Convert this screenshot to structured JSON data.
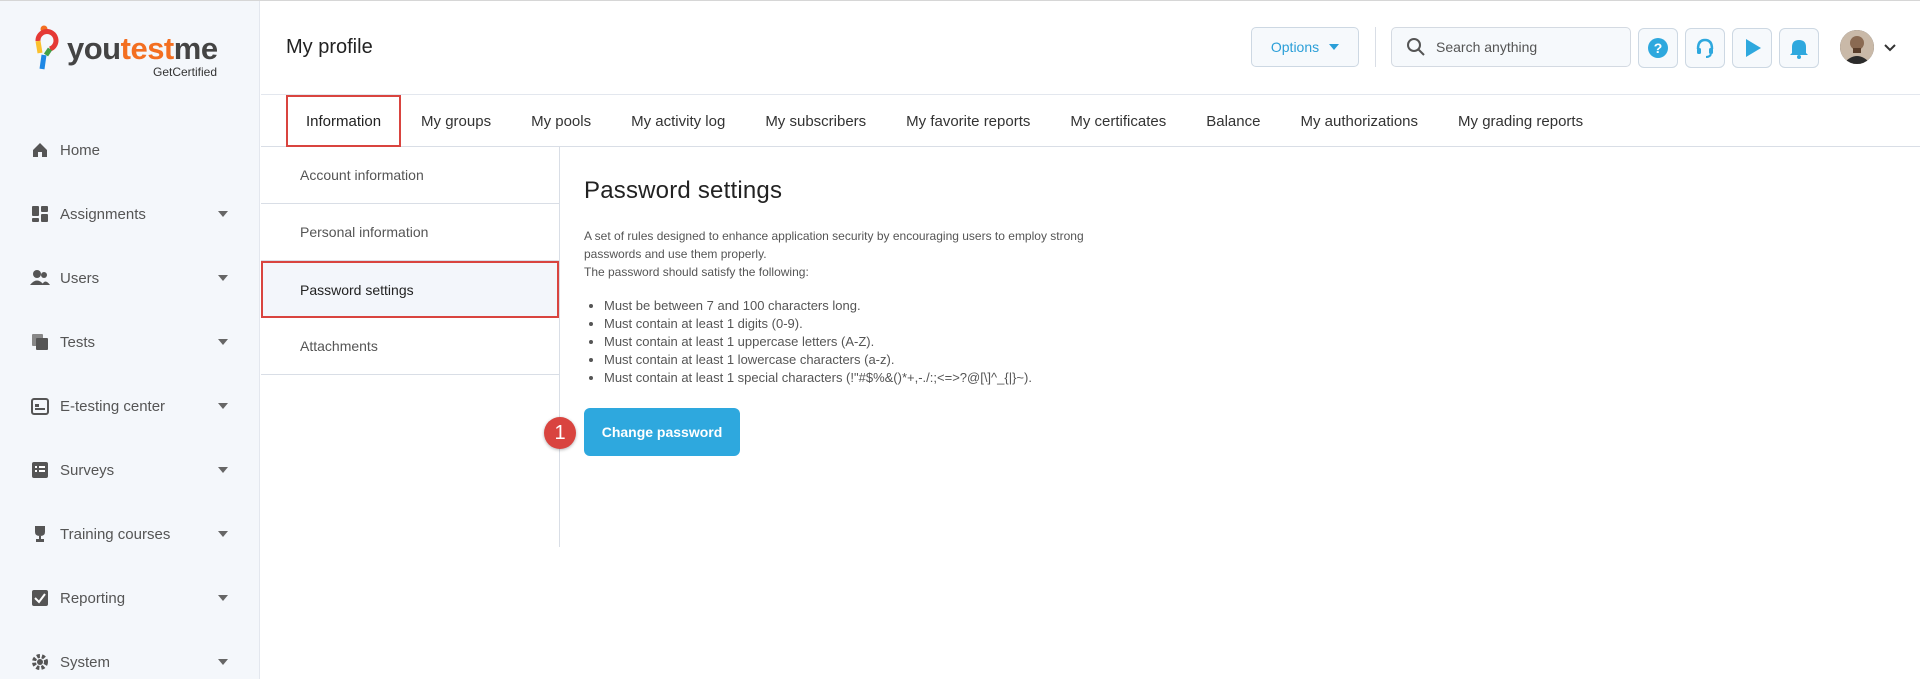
{
  "brand": {
    "name_you": "you",
    "name_test": "test",
    "name_me": "me",
    "tagline": "GetCertified"
  },
  "sidebar": {
    "items": [
      {
        "label": "Home",
        "icon": "home-icon",
        "has_caret": false
      },
      {
        "label": "Assignments",
        "icon": "dashboard-icon",
        "has_caret": true
      },
      {
        "label": "Users",
        "icon": "users-icon",
        "has_caret": true
      },
      {
        "label": "Tests",
        "icon": "tests-icon",
        "has_caret": true
      },
      {
        "label": "E-testing center",
        "icon": "calendar-icon",
        "has_caret": true
      },
      {
        "label": "Surveys",
        "icon": "list-icon",
        "has_caret": true
      },
      {
        "label": "Training courses",
        "icon": "trophy-icon",
        "has_caret": true
      },
      {
        "label": "Reporting",
        "icon": "check-square-icon",
        "has_caret": true
      },
      {
        "label": "System",
        "icon": "gear-icon",
        "has_caret": true
      }
    ]
  },
  "header": {
    "title": "My profile",
    "options_label": "Options",
    "search_placeholder": "Search anything"
  },
  "tabs": [
    {
      "label": "Information",
      "active": true
    },
    {
      "label": "My groups"
    },
    {
      "label": "My pools"
    },
    {
      "label": "My activity log"
    },
    {
      "label": "My subscribers"
    },
    {
      "label": "My favorite reports"
    },
    {
      "label": "My certificates"
    },
    {
      "label": "Balance"
    },
    {
      "label": "My authorizations"
    },
    {
      "label": "My grading reports"
    }
  ],
  "subnav": [
    {
      "label": "Account information"
    },
    {
      "label": "Personal information"
    },
    {
      "label": "Password settings",
      "active": true
    },
    {
      "label": "Attachments"
    }
  ],
  "content": {
    "title": "Password settings",
    "description_1": "A set of rules designed to enhance application security by encouraging users to employ strong passwords and use them properly.",
    "description_2": "The password should satisfy the following:",
    "rules": [
      "Must be between 7 and 100 characters long.",
      "Must contain at least 1 digits (0-9).",
      "Must contain at least 1 uppercase letters (A-Z).",
      "Must contain at least 1 lowercase characters (a-z).",
      "Must contain at least 1 special characters (!\"#$%&()*+,-./:;<=>?@[\\]^_{|}~)."
    ],
    "change_password_label": "Change password",
    "step_number": "1"
  },
  "colors": {
    "accent": "#2ea8de",
    "highlight": "#d9443f",
    "sidebar_bg": "#f4f7fb"
  }
}
